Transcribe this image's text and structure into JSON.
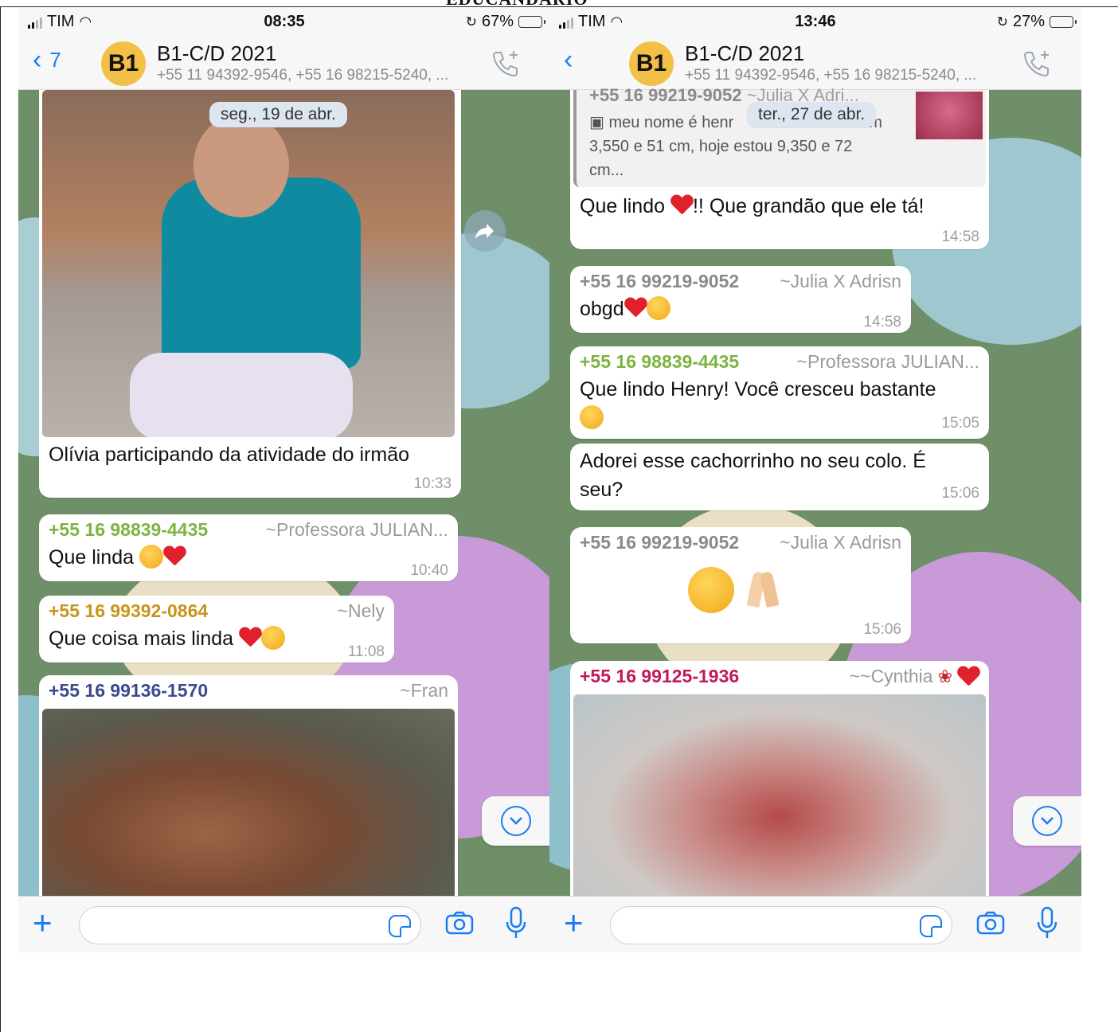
{
  "document": {
    "heading": "EDUCANDÁRIO"
  },
  "left": {
    "status": {
      "carrier": "TIM",
      "time": "08:35",
      "battery": "67%",
      "battery_level": 0.67,
      "battery_color": "#111111"
    },
    "header": {
      "back_count": "7",
      "avatar": "B1",
      "title": "B1-C/D 2021",
      "members": "+55 11 94392-9546, +55 16 98215-5240, ..."
    },
    "date_pill": "seg., 19 de abr.",
    "messages": [
      {
        "text": "Olívia participando da atividade do irmão",
        "time": "10:33"
      },
      {
        "phone": "+55 16 98839-4435",
        "alias": "~Professora JULIAN...",
        "phone_color": "#7cb342",
        "text": "Que linda",
        "time": "10:40"
      },
      {
        "phone": "+55 16 99392-0864",
        "alias": "~Nely",
        "phone_color": "#c8951a",
        "text": "Que coisa mais linda",
        "time": "11:08"
      },
      {
        "phone": "+55 16 99136-1570",
        "alias": "~Fran",
        "phone_color": "#3b4a8f"
      }
    ]
  },
  "right": {
    "status": {
      "carrier": "TIM",
      "time": "13:46",
      "battery": "27%",
      "battery_level": 0.27,
      "battery_color": "#f0c419"
    },
    "header": {
      "avatar": "B1",
      "title": "B1-C/D 2021",
      "members": "+55 11 94392-9546, +55 16 98215-5240, ..."
    },
    "date_pill": "ter., 27 de abr.",
    "quote": {
      "sender": "+55 16 99219-9052",
      "alias": "~Julia X Adri...",
      "line1": "meu nome é henr",
      "line1_end": "m",
      "line2": "3,550 e 51 cm, hoje estou 9,350 e 72",
      "line3": "cm..."
    },
    "messages": [
      {
        "text_a": "Que lindo",
        "text_b": "!! Que grandão que ele tá!",
        "time": "14:58"
      },
      {
        "phone": "+55 16 99219-9052",
        "alias": "~Julia X Adrisn",
        "phone_color": "#8a8a8a",
        "text": "obgd",
        "time": "14:58"
      },
      {
        "phone": "+55 16 98839-4435",
        "alias": "~Professora JULIAN...",
        "phone_color": "#7cb342",
        "text": "Que lindo Henry! Você cresceu bastante",
        "time": "15:05"
      },
      {
        "text_a": "Adorei esse cachorrinho no seu colo. É",
        "text_b": "seu?",
        "time": "15:06"
      },
      {
        "phone": "+55 16 99219-9052",
        "alias": "~Julia X Adrisn",
        "phone_color": "#8a8a8a",
        "time": "15:06"
      },
      {
        "phone": "+55 16 99125-1936",
        "alias": "~~Cynthia",
        "phone_color": "#c2185b"
      }
    ]
  },
  "colors": {
    "accent": "#1a7cf2",
    "bubble": "#ffffff",
    "date_pill": "#dde6f0"
  },
  "icons": [
    "back-chevron-icon",
    "call-add-icon",
    "forward-icon",
    "scroll-down-icon",
    "plus-icon",
    "sticker-icon",
    "camera-icon",
    "mic-icon"
  ]
}
